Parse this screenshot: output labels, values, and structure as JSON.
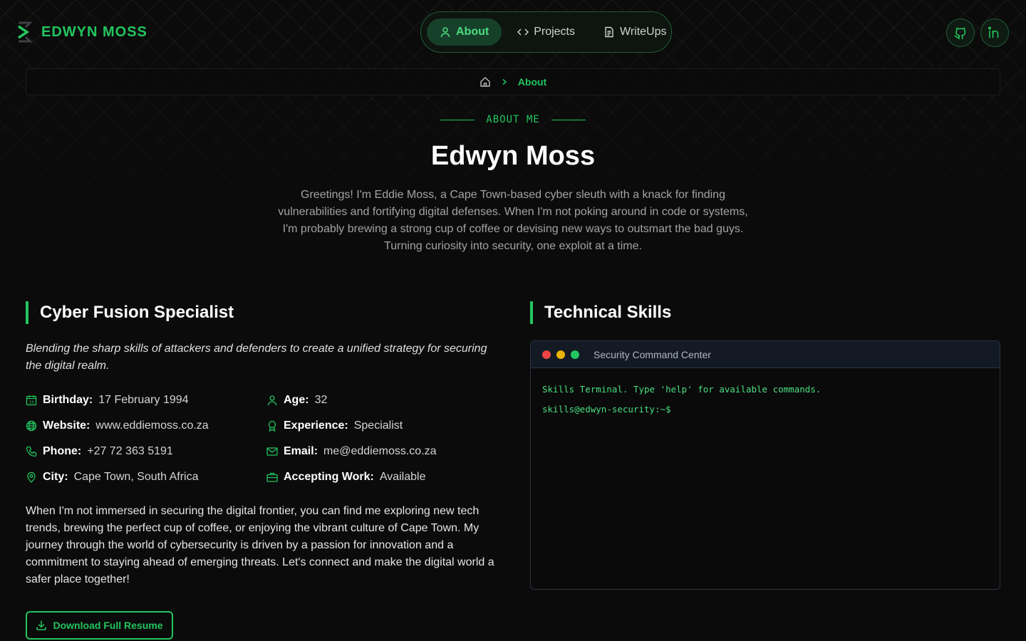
{
  "brand": {
    "name": "EDWYN MOSS"
  },
  "nav": [
    {
      "label": "About",
      "icon": "user-icon",
      "active": true
    },
    {
      "label": "Projects",
      "icon": "code-icon",
      "active": false
    },
    {
      "label": "WriteUps",
      "icon": "document-icon",
      "active": false
    }
  ],
  "social": [
    {
      "icon": "github-icon"
    },
    {
      "icon": "linkedin-icon"
    }
  ],
  "breadcrumb": {
    "home_icon": "home-icon",
    "current": "About"
  },
  "hero": {
    "eyebrow": "ABOUT ME",
    "name": "Edwyn Moss",
    "intro": "Greetings! I'm Eddie Moss, a Cape Town-based cyber sleuth with a knack for finding vulnerabilities and fortifying digital defenses. When I'm not poking around in code or systems, I'm probably brewing a strong cup of coffee or devising new ways to outsmart the bad guys. Turning curiosity into security, one exploit at a time."
  },
  "profile": {
    "title": "Cyber Fusion Specialist",
    "tagline": "Blending the sharp skills of attackers and defenders to create a unified strategy for securing the digital realm.",
    "facts": [
      {
        "icon": "calendar-icon",
        "label": "Birthday:",
        "value": "17 February 1994"
      },
      {
        "icon": "user-icon",
        "label": "Age:",
        "value": "32"
      },
      {
        "icon": "globe-icon",
        "label": "Website:",
        "value": "www.eddiemoss.co.za"
      },
      {
        "icon": "award-icon",
        "label": "Experience:",
        "value": "Specialist"
      },
      {
        "icon": "phone-icon",
        "label": "Phone:",
        "value": "+27 72 363 5191"
      },
      {
        "icon": "mail-icon",
        "label": "Email:",
        "value": "me@eddiemoss.co.za"
      },
      {
        "icon": "map-pin-icon",
        "label": "City:",
        "value": "Cape Town, South Africa"
      },
      {
        "icon": "briefcase-icon",
        "label": "Accepting Work:",
        "value": "Available"
      }
    ],
    "bio": "When I'm not immersed in securing the digital frontier, you can find me exploring new tech trends, brewing the perfect cup of coffee, or enjoying the vibrant culture of Cape Town. My journey through the world of cybersecurity is driven by a passion for innovation and a commitment to staying ahead of emerging threats. Let's connect and make the digital world a safer place together!",
    "resume_button": "Download Full Resume"
  },
  "skills": {
    "title": "Technical Skills",
    "terminal": {
      "title": "Security Command Center",
      "welcome": "Skills Terminal. Type 'help' for available commands.",
      "prompt": "skills@edwyn-security:~$",
      "input_value": ""
    }
  },
  "colors": {
    "accent": "#22c55e",
    "background": "#0b0b0b",
    "dot_red": "#ef4444",
    "dot_yellow": "#eab308",
    "dot_green": "#22c55e"
  }
}
